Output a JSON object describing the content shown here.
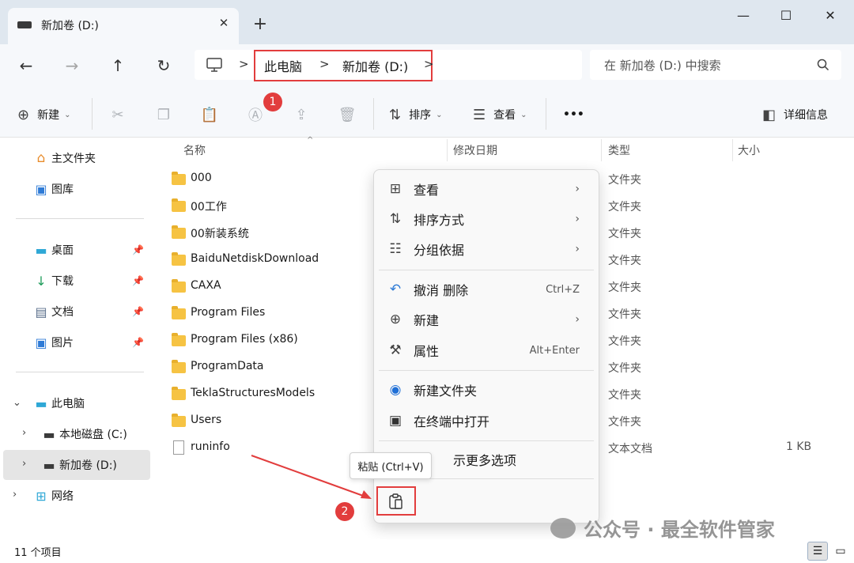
{
  "tab": {
    "title": "新加卷 (D:)",
    "close_glyph": "✕"
  },
  "window": {
    "new_tab_glyph": "+",
    "minimize": "—",
    "maximize": "☐",
    "close": "✕"
  },
  "nav": {
    "back": "←",
    "forward": "→",
    "up": "↑",
    "refresh": "↻"
  },
  "breadcrumb": {
    "items": [
      "此电脑",
      "新加卷 (D:)"
    ],
    "sep": ">"
  },
  "search": {
    "placeholder": "在 新加卷 (D:) 中搜索"
  },
  "commands": {
    "new_label": "新建",
    "sort_label": "排序",
    "view_label": "查看",
    "more_label": "•••",
    "details_label": "详细信息"
  },
  "sidebar": {
    "home": "主文件夹",
    "gallery": "图库",
    "desktop": "桌面",
    "downloads": "下载",
    "documents": "文档",
    "pictures": "图片",
    "thispc": "此电脑",
    "local_c": "本地磁盘 (C:)",
    "new_d": "新加卷 (D:)",
    "network": "网络"
  },
  "columns": {
    "name": "名称",
    "modified": "修改日期",
    "type": "类型",
    "size": "大小"
  },
  "files": [
    {
      "name": "000",
      "type": "文件夹",
      "size": ""
    },
    {
      "name": "00工作",
      "type": "文件夹",
      "size": ""
    },
    {
      "name": "00新装系统",
      "type": "文件夹",
      "size": ""
    },
    {
      "name": "BaiduNetdiskDownload",
      "type": "文件夹",
      "size": ""
    },
    {
      "name": "CAXA",
      "type": "文件夹",
      "size": ""
    },
    {
      "name": "Program Files",
      "type": "文件夹",
      "size": ""
    },
    {
      "name": "Program Files (x86)",
      "type": "文件夹",
      "size": ""
    },
    {
      "name": "ProgramData",
      "type": "文件夹",
      "size": ""
    },
    {
      "name": "TeklaStructuresModels",
      "type": "文件夹",
      "size": ""
    },
    {
      "name": "Users",
      "type": "文件夹",
      "size": ""
    },
    {
      "name": "runinfo",
      "type": "文本文档",
      "size": "1 KB"
    }
  ],
  "context_menu": {
    "view": "查看",
    "sort": "排序方式",
    "group": "分组依据",
    "undo": "撤消 删除",
    "undo_shortcut": "Ctrl+Z",
    "new": "新建",
    "properties": "属性",
    "properties_shortcut": "Alt+Enter",
    "new_folder": "新建文件夹",
    "terminal": "在终端中打开",
    "more_options": "示更多选项",
    "paste_tooltip": "粘贴 (Ctrl+V)"
  },
  "annotations": {
    "badge1": "1",
    "badge2": "2",
    "color": "#e23d3d"
  },
  "status": {
    "count": "11 个项目"
  },
  "watermark": {
    "text": "公众号 · 最全软件管家"
  }
}
